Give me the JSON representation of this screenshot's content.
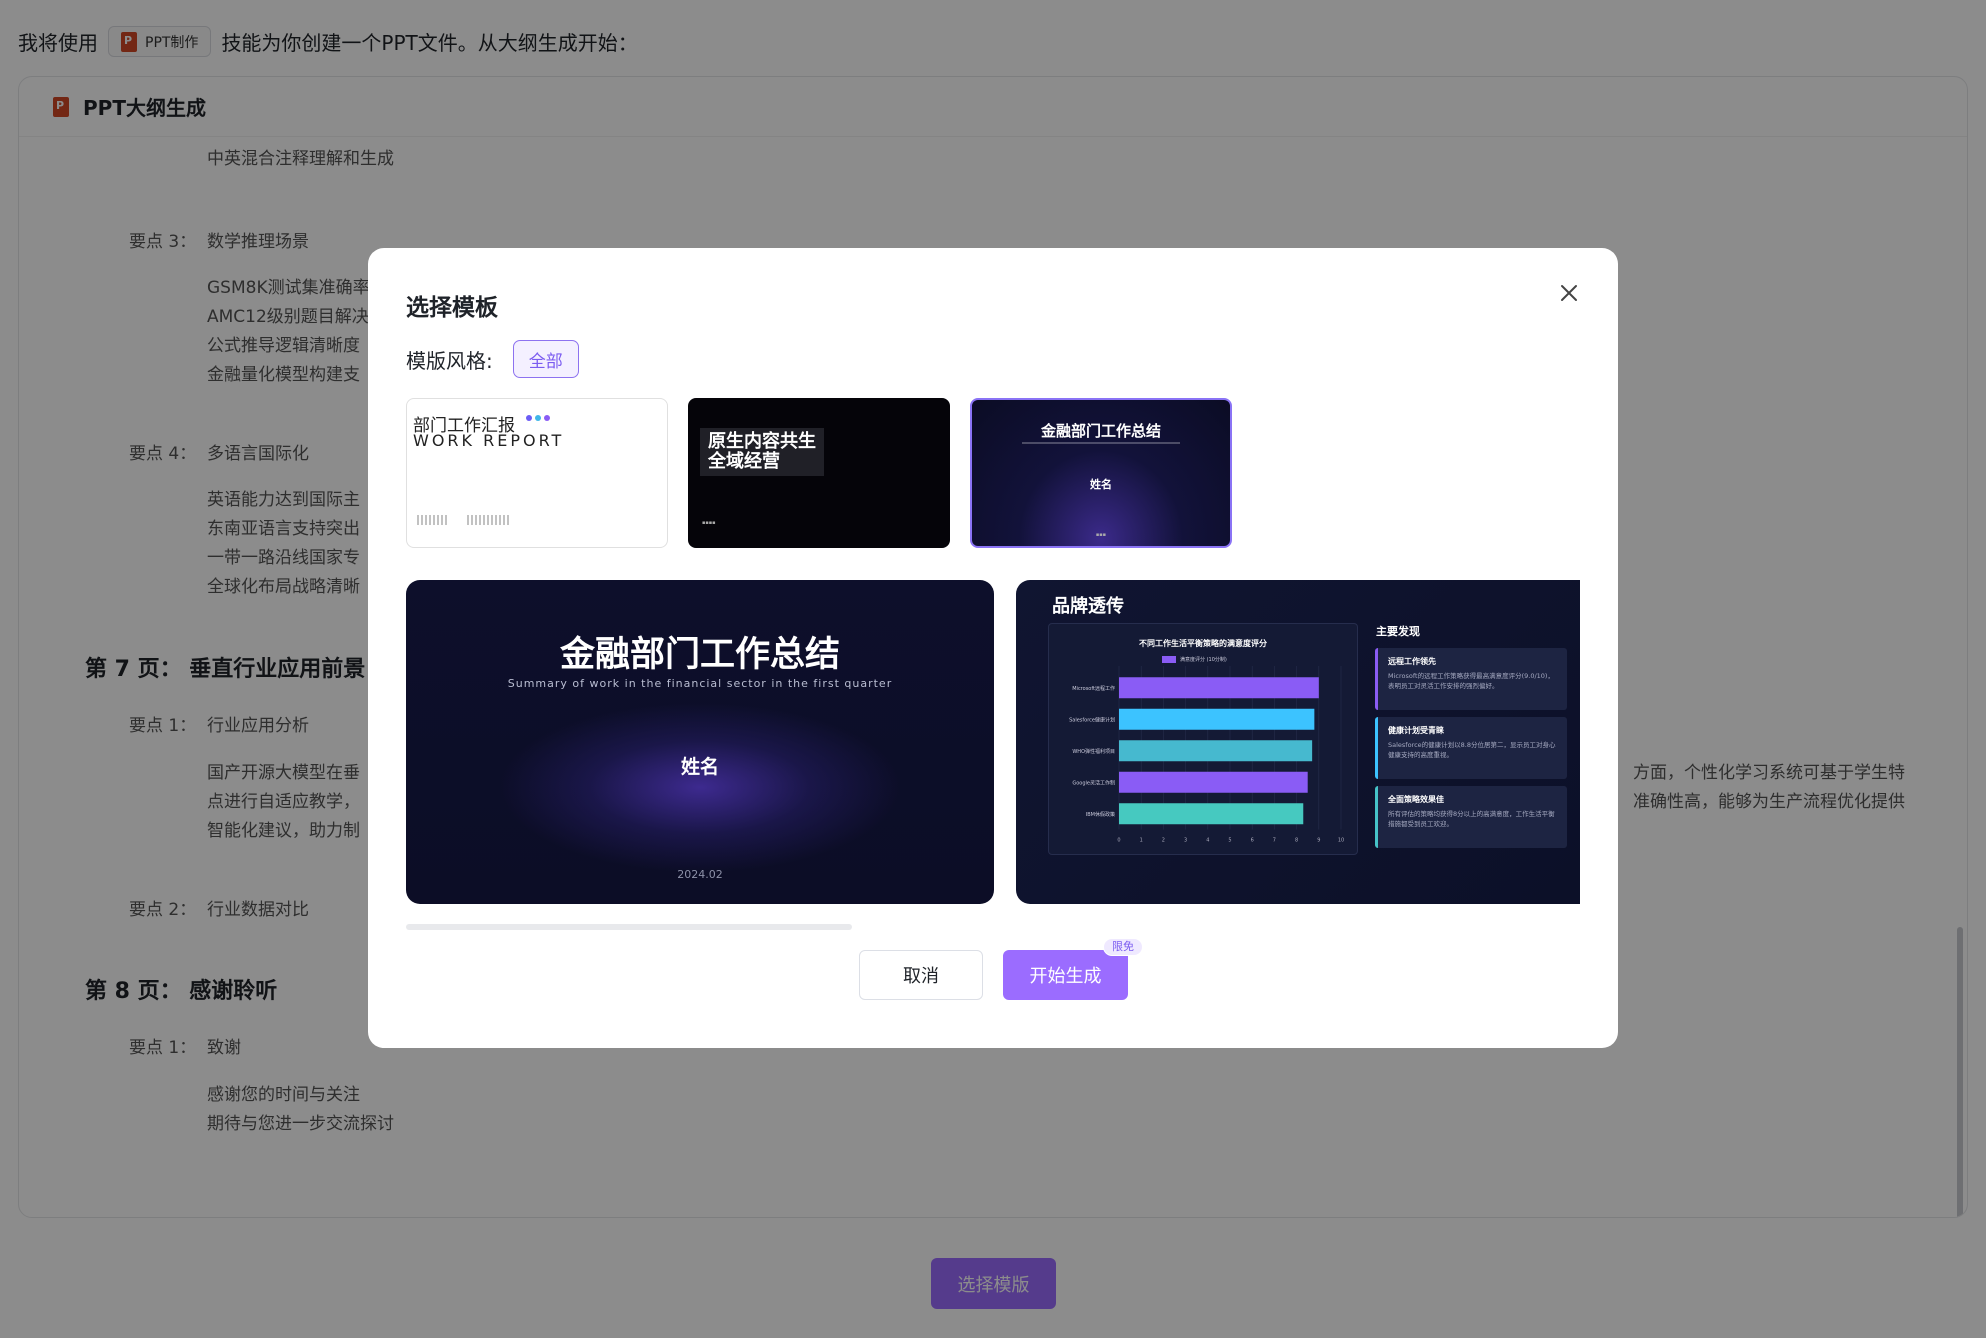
{
  "intro": {
    "before": "我将使用",
    "skill_label": "PPT制作",
    "after": "技能为你创建一个PPT文件。从大纲生成开始："
  },
  "outline": {
    "title": "PPT大纲生成",
    "lines": {
      "l0": "中英混合注释理解和生成",
      "p3_label": "要点 3：",
      "p3_text": "数学推理场景",
      "p3_s1": "GSM8K测试集准确率",
      "p3_s2": "AMC12级别题目解决",
      "p3_s3": "公式推导逻辑清晰度",
      "p3_s4": "金融量化模型构建支",
      "p4_label": "要点 4：",
      "p4_text": "多语言国际化",
      "p4_s1": "英语能力达到国际主",
      "p4_s2": "东南亚语言支持突出",
      "p4_s3": "一带一路沿线国家专",
      "p4_s4": "全球化布局战略清晰",
      "page7": "第 7 页：  垂直行业应用前景",
      "pg7_p1_label": "要点 1：",
      "pg7_p1_text": "行业应用分析",
      "pg7_para1": "国产开源大模型在垂",
      "pg7_para1_right": "方面，个性化学习系统可基于学生特",
      "pg7_para2": "点进行自适应教学，",
      "pg7_para2_right": "准确性高，能够为生产流程优化提供",
      "pg7_para3": "智能化建议，助力制",
      "pg7_p2_label": "要点 2：",
      "pg7_p2_text": "行业数据对比",
      "page8": "第 8 页：  感谢聆听",
      "pg8_p1_label": "要点 1：",
      "pg8_p1_text": "致谢",
      "pg8_s1": "感谢您的时间与关注",
      "pg8_s2": "期待与您进一步交流探讨"
    }
  },
  "bottom_button": "选择模版",
  "modal": {
    "title": "选择模板",
    "filter_label": "模版风格:",
    "filter_value": "全部",
    "cancel": "取消",
    "start": "开始生成",
    "badge": "限免"
  },
  "templates": {
    "t1": {
      "title": "部门工作汇报",
      "subtitle": "WORK REPORT"
    },
    "t2": {
      "title_line1": "原生内容共生",
      "title_line2": "全域经营"
    },
    "t3": {
      "title": "金融部门工作总结",
      "name": "姓名"
    }
  },
  "preview1": {
    "title": "金融部门工作总结",
    "subtitle": "Summary of work in the financial sector in the first quarter",
    "name": "姓名",
    "date": "2024.02"
  },
  "preview2": {
    "title": "品牌透传",
    "findings_title": "主要发现",
    "findings": [
      {
        "title": "远程工作领先",
        "text": "Microsoft的远程工作策略获得最高满意度评分(9.0/10)，表明员工对灵活工作安排的强烈偏好。",
        "color": "#8a5cf5"
      },
      {
        "title": "健康计划受青睐",
        "text": "Salesforce的健康计划以8.8分位居第二，显示员工对身心健康支持的高度重视。",
        "color": "#3cc3ff"
      },
      {
        "title": "全面策略效果佳",
        "text": "所有评估的策略均获得8分以上的高满意度，工作生活平衡措施都受到员工欢迎。",
        "color": "#46c3c8"
      }
    ]
  },
  "chart_data": {
    "type": "bar",
    "title": "不同工作生活平衡策略的满意度评分",
    "orientation": "horizontal",
    "categories": [
      "Microsoft远程工作",
      "Salesforce健康计划",
      "WHO弹性福利项目",
      "Google灵活工作制",
      "IBM休假政策"
    ],
    "series": [
      {
        "name": "满意度评分 (10分制)",
        "values": [
          9.0,
          8.8,
          8.7,
          8.5,
          8.3
        ]
      }
    ],
    "colors": [
      "#8a5cf5",
      "#3cc3ff",
      "#46b9cf",
      "#8a5cf5",
      "#46c9c0"
    ],
    "xlim": [
      0,
      10
    ],
    "xticks": [
      "0",
      "1",
      "2",
      "3",
      "4",
      "5",
      "6",
      "7",
      "8",
      "9",
      "10"
    ],
    "grid": true,
    "legend": "top"
  }
}
